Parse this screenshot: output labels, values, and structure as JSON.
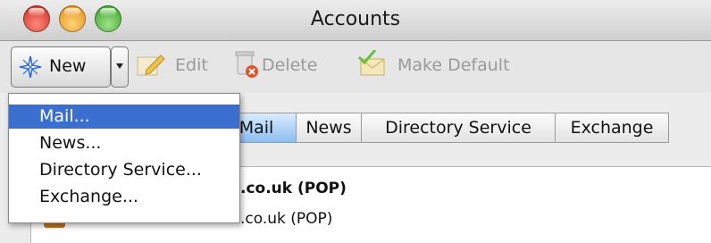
{
  "window": {
    "title": "Accounts"
  },
  "toolbar": {
    "new": {
      "label": "New",
      "icon": "sparkle-icon"
    },
    "edit": {
      "label": "Edit",
      "icon": "edit-pencil-icon"
    },
    "delete": {
      "label": "Delete",
      "icon": "trash-icon"
    },
    "make_default": {
      "label": "Make Default",
      "icon": "envelope-check-icon"
    }
  },
  "new_menu": {
    "items": [
      {
        "label": "Mail...",
        "selected": true
      },
      {
        "label": "News...",
        "selected": false
      },
      {
        "label": "Directory Service...",
        "selected": false
      },
      {
        "label": "Exchange...",
        "selected": false
      }
    ]
  },
  "tabs": [
    {
      "label": "Mail",
      "active": true
    },
    {
      "label": "News",
      "active": false
    },
    {
      "label": "Directory Service",
      "active": false
    },
    {
      "label": "Exchange",
      "active": false
    }
  ],
  "accounts": [
    {
      "visible_text": ".co.uk (POP)",
      "bold": true
    },
    {
      "visible_text": ".co.uk (POP)",
      "bold": false
    }
  ],
  "colors": {
    "menu_highlight": "#3a6fcf",
    "active_tab": "#8cbef0"
  }
}
